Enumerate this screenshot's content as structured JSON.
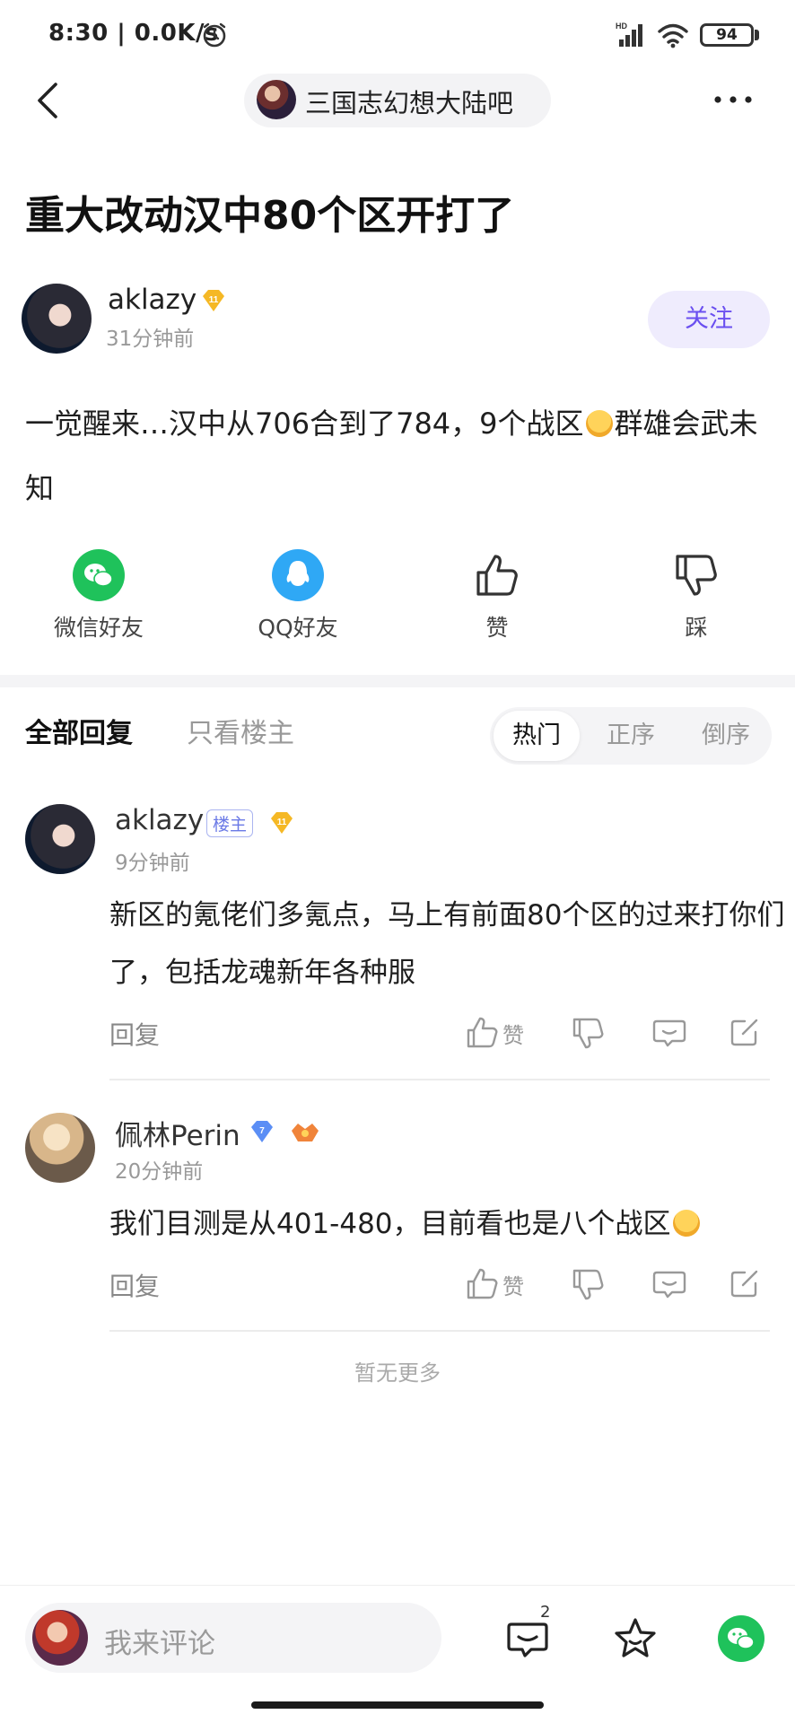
{
  "status_bar": {
    "time": "8:30 | 0.0K/s",
    "battery": "94"
  },
  "nav": {
    "forum_name": "三国志幻想大陆吧"
  },
  "post": {
    "title": "重大改动汉中80个区开打了",
    "author": {
      "name": "aklazy",
      "level": "11",
      "time": "31分钟前"
    },
    "follow_label": "关注",
    "body_part1": "一觉醒来…汉中从706合到了784，9个战区",
    "body_part2": "群雄会武未知"
  },
  "share": [
    {
      "label": "微信好友",
      "icon": "wechat-icon"
    },
    {
      "label": "QQ好友",
      "icon": "qq-icon"
    },
    {
      "label": "赞",
      "icon": "thumbs-up-icon"
    },
    {
      "label": "踩",
      "icon": "thumbs-down-icon"
    }
  ],
  "filter": {
    "tab_all": "全部回复",
    "tab_op": "只看楼主",
    "sort_options": [
      "热门",
      "正序",
      "倒序"
    ],
    "sort_selected": "热门"
  },
  "comments": [
    {
      "name": "aklazy",
      "op_tag": "楼主",
      "level": "11",
      "time": "9分钟前",
      "body": "新区的氪佬们多氪点，马上有前面80个区的过来打你们了，包括龙魂新年各种服",
      "reply_label": "回复",
      "like_label": "赞"
    },
    {
      "name": "佩林Perin",
      "level": "7",
      "time": "20分钟前",
      "body": "我们目测是从401-480，目前看也是八个战区",
      "reply_label": "回复",
      "like_label": "赞"
    }
  ],
  "no_more": "暂无更多",
  "bottom": {
    "comment_placeholder": "我来评论",
    "message_count": "2"
  },
  "colors": {
    "accent": "#6a4ff0",
    "wechat": "#1fc25b",
    "qq": "#2fa8f5",
    "level_gold": "#f5b825",
    "level_blue": "#5b8ef5"
  }
}
